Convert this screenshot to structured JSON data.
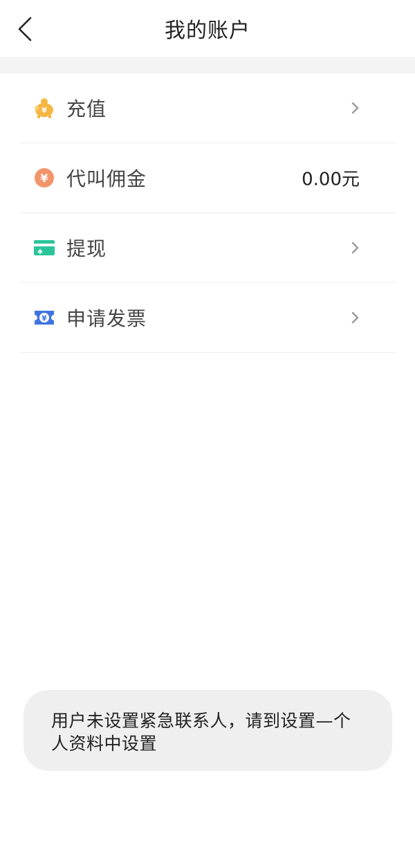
{
  "header": {
    "title": "我的账户",
    "back_icon": "chevron-left-icon"
  },
  "menu": [
    {
      "id": "recharge",
      "label": "充值",
      "icon": "piggy-bank-icon",
      "icon_color": "#F6B742",
      "right_value": null
    },
    {
      "id": "commission",
      "label": "代叫佣金",
      "icon": "yuan-coin-icon",
      "icon_color": "#F2956A",
      "right_value": "0.00元"
    },
    {
      "id": "withdraw",
      "label": "提现",
      "icon": "card-withdraw-icon",
      "icon_color": "#2BC59B",
      "right_value": null
    },
    {
      "id": "invoice",
      "label": "申请发票",
      "icon": "invoice-ticket-icon",
      "icon_color": "#3E74E0",
      "right_value": null
    }
  ],
  "toast": {
    "message": "用户未设置紧急联系人，请到设置—个人资料中设置"
  },
  "colors": {
    "background": "#FFFFFF",
    "band": "#F4F4F4",
    "divider": "#EEEEEE",
    "toast_bg": "#EFEFEF"
  }
}
